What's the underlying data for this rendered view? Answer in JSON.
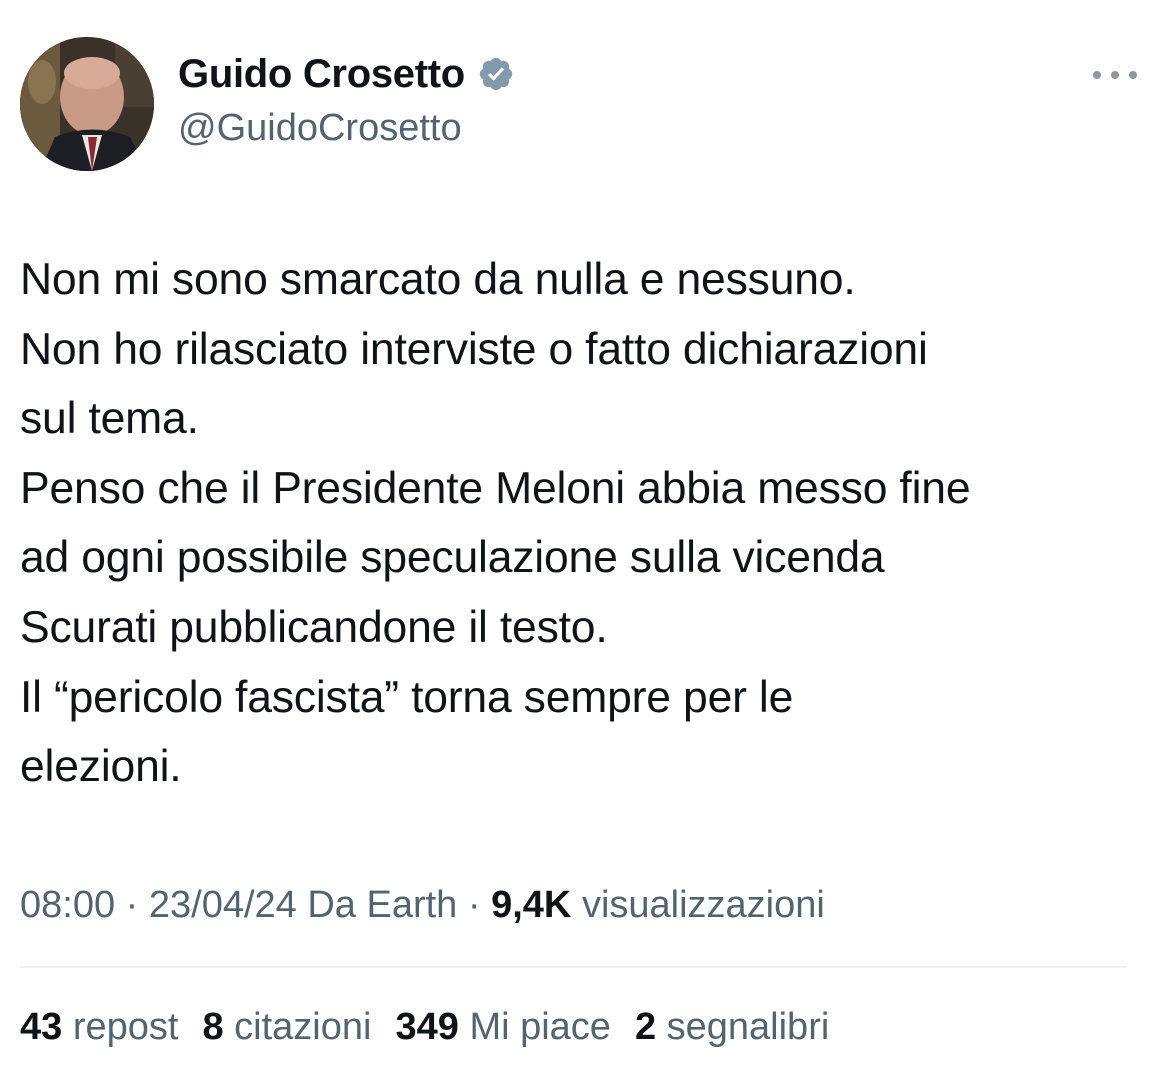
{
  "author": {
    "display_name": "Guido Crosetto",
    "handle": "@GuidoCrosetto",
    "verified_badge_icon": "verified-badge-icon",
    "verified_color": "#829aab"
  },
  "tweet": {
    "lines": [
      "Non mi sono smarcato da nulla e nessuno.",
      "Non ho rilasciato interviste o fatto dichiarazioni",
      "sul tema.",
      "Penso che il Presidente Meloni abbia messo fine",
      "ad ogni possibile speculazione sulla vicenda",
      "Scurati pubblicandone il testo.",
      "Il “pericolo fascista” torna sempre per le",
      "elezioni."
    ]
  },
  "meta": {
    "time": "08:00",
    "separator": "·",
    "date_source": "23/04/24 Da Earth",
    "views_count": "9,4K",
    "views_label": "visualizzazioni"
  },
  "stats": [
    {
      "count": "43",
      "label": "repost"
    },
    {
      "count": "8",
      "label": "citazioni"
    },
    {
      "count": "349",
      "label": "Mi piace"
    },
    {
      "count": "2",
      "label": "segnalibri"
    }
  ],
  "colors": {
    "text_primary": "#0f1419",
    "text_secondary": "#536471",
    "divider": "#eff3f4"
  }
}
